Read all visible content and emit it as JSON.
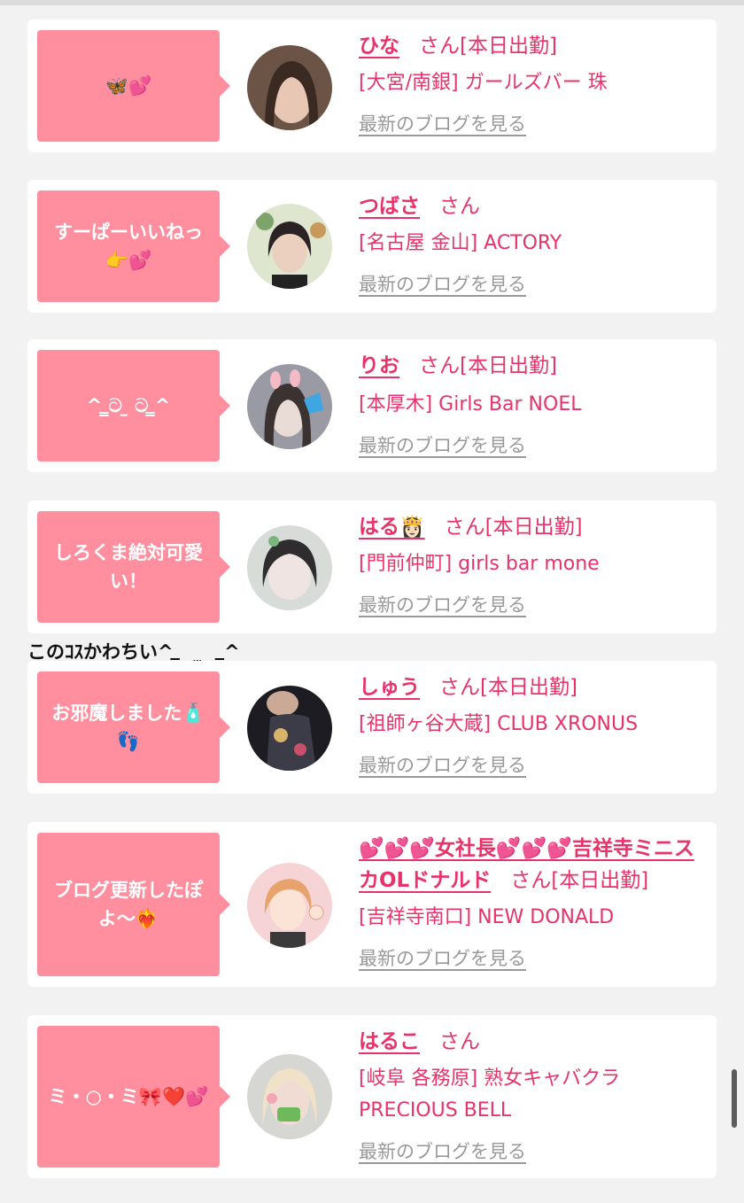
{
  "cards": [
    {
      "comment": "🦋💕",
      "name": "ひな",
      "suffix": "さん[本日出勤]",
      "shop": "[大宮/南銀] ガールズバー 珠",
      "link": "最新のブログを見る"
    },
    {
      "comment": "すーぱーいいねっ👉💕",
      "name": "つばさ",
      "suffix": "さん",
      "shop": "[名古屋 金山] ACTORY",
      "link": "最新のブログを見る"
    },
    {
      "comment": "^ ̳ට ̫ ට ̳^",
      "name": "りお",
      "suffix": "さん[本日出勤]",
      "shop": "[本厚木] Girls Bar NOEL",
      "link": "最新のブログを見る"
    },
    {
      "comment": "しろくま絶対可愛い！",
      "name": "はる👸🏻",
      "suffix": "さん[本日出勤]",
      "shop": "[門前仲町] girls bar mone",
      "link": "最新のブログを見る"
    },
    {
      "comment": "お邪魔しました🧴👣",
      "name": "しゅう",
      "suffix": "さん[本日出勤]",
      "shop": "[祖師ヶ谷大蔵] CLUB XRONUS",
      "link": "最新のブログを見る"
    },
    {
      "comment": "ブログ更新したぽよ〜❤️‍🔥",
      "name": "💕💕💕女社長💕💕💕吉祥寺ミニスカOLドナルド",
      "suffix": "さん[本日出勤]",
      "shop": "[吉祥寺南口] NEW DONALD",
      "link": "最新のブログを見る"
    },
    {
      "comment": "ミ・○・ミ🎀❤️💕",
      "name": "はるこ",
      "suffix": "さん",
      "shop": "[岐阜 各務原]  熟女キャバクラ PRECIOUS BELL",
      "link": "最新のブログを見る"
    }
  ],
  "overlay_comment": "このｺｽかわちい^ ̳ _ ̫ _ ̳^",
  "colors": {
    "accent": "#e8336a",
    "bubble": "#ff8e9f",
    "link": "#999999",
    "background": "#f2f2f2"
  }
}
